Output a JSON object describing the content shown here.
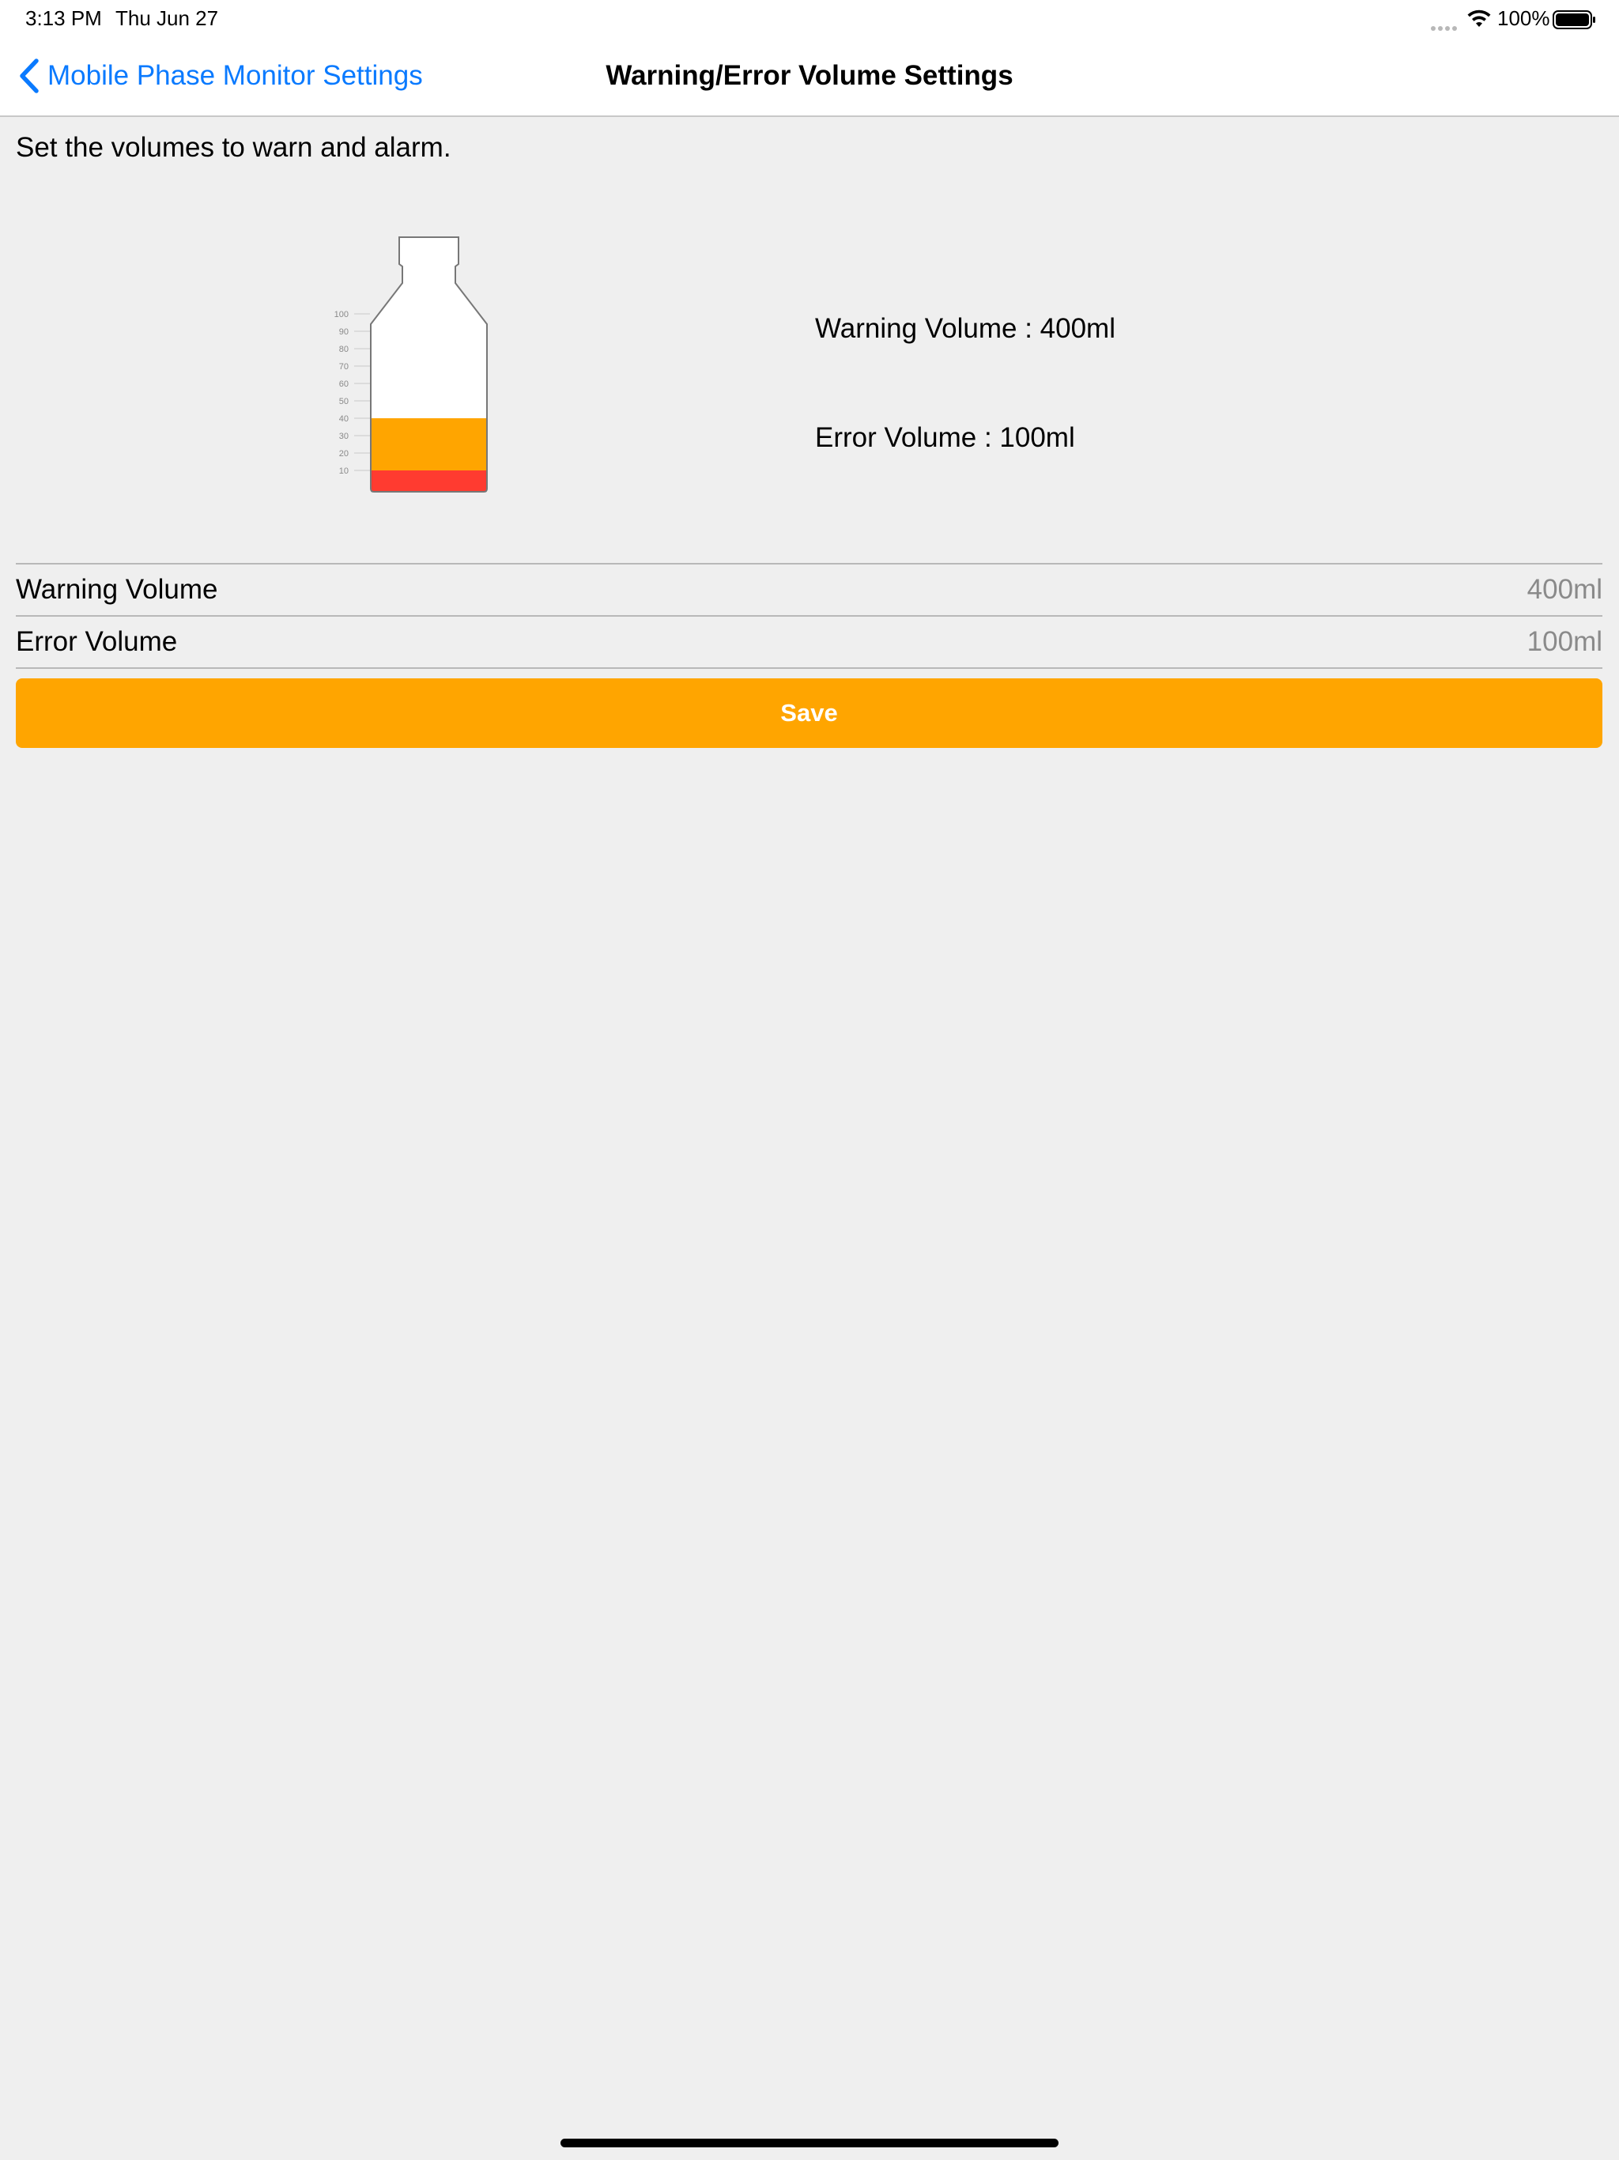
{
  "status_bar": {
    "time": "3:13 PM",
    "date": "Thu Jun 27",
    "battery": "100%",
    "icons": [
      "signal-dots-icon",
      "wifi-icon",
      "battery-icon"
    ]
  },
  "nav": {
    "back_label": "Mobile Phase Monitor Settings",
    "back_icon": "chevron-left-icon",
    "title": "Warning/Error Volume Settings"
  },
  "description": "Set the volumes to warn and alarm.",
  "bottle": {
    "scale_labels": [
      "100",
      "90",
      "80",
      "70",
      "60",
      "50",
      "40",
      "30",
      "20",
      "10"
    ],
    "warning_level_percent": 40,
    "error_level_percent": 10,
    "warning_color": "#ffa500",
    "error_color": "#ff3b30"
  },
  "info": {
    "warning_text": "Warning Volume : 400ml",
    "error_text": "Error Volume : 100ml"
  },
  "table": {
    "rows": [
      {
        "label": "Warning Volume",
        "value": "400ml"
      },
      {
        "label": "Error Volume",
        "value": "100ml"
      }
    ]
  },
  "save_label": "Save",
  "colors": {
    "accent": "#0a7aff",
    "save_button": "#ffa500",
    "background": "#efefef"
  }
}
